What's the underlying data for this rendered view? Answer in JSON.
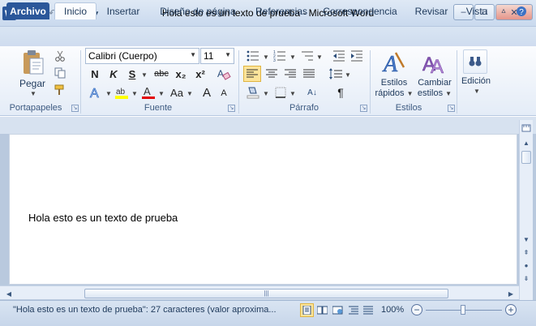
{
  "window": {
    "title": "Hola esto es un texto de prueba  -  Microsoft Word",
    "app_icon": "W",
    "min_label": "–",
    "max_label": "□",
    "close_label": "✕"
  },
  "tabs": [
    "Archivo",
    "Inicio",
    "Insertar",
    "Diseño de página",
    "Referencias",
    "Correspondencia",
    "Revisar",
    "Vista"
  ],
  "ribbon": {
    "clipboard": {
      "paste_label": "Pegar",
      "group_label": "Portapapeles"
    },
    "font": {
      "font_name": "Calibri (Cuerpo)",
      "font_size": "11",
      "group_label": "Fuente"
    },
    "paragraph": {
      "group_label": "Párrafo"
    },
    "styles": {
      "quick_label_1": "Estilos",
      "quick_label_2": "rápidos",
      "change_label_1": "Cambiar",
      "change_label_2": "estilos",
      "group_label": "Estilos"
    },
    "editing": {
      "label": "Edición"
    }
  },
  "document": {
    "text": "Hola esto es un texto de prueba"
  },
  "status": {
    "text": "\"Hola esto es un texto de prueba\": 27 caracteres (valor aproxima...",
    "zoom": "100%",
    "zoom_minus": "−",
    "zoom_plus": "+"
  },
  "icons": {
    "bold": "N",
    "italic": "K",
    "underline": "S",
    "strike": "abc",
    "subscript": "x₂",
    "superscript": "x²",
    "grow": "A",
    "shrink": "A",
    "case": "Aa",
    "pilcrow": "¶",
    "sort": "A↓",
    "edit_icon": "👓"
  },
  "colors": {
    "accent": "#2b579a",
    "highlight": "#ffff00",
    "font_color": "#e30000"
  }
}
